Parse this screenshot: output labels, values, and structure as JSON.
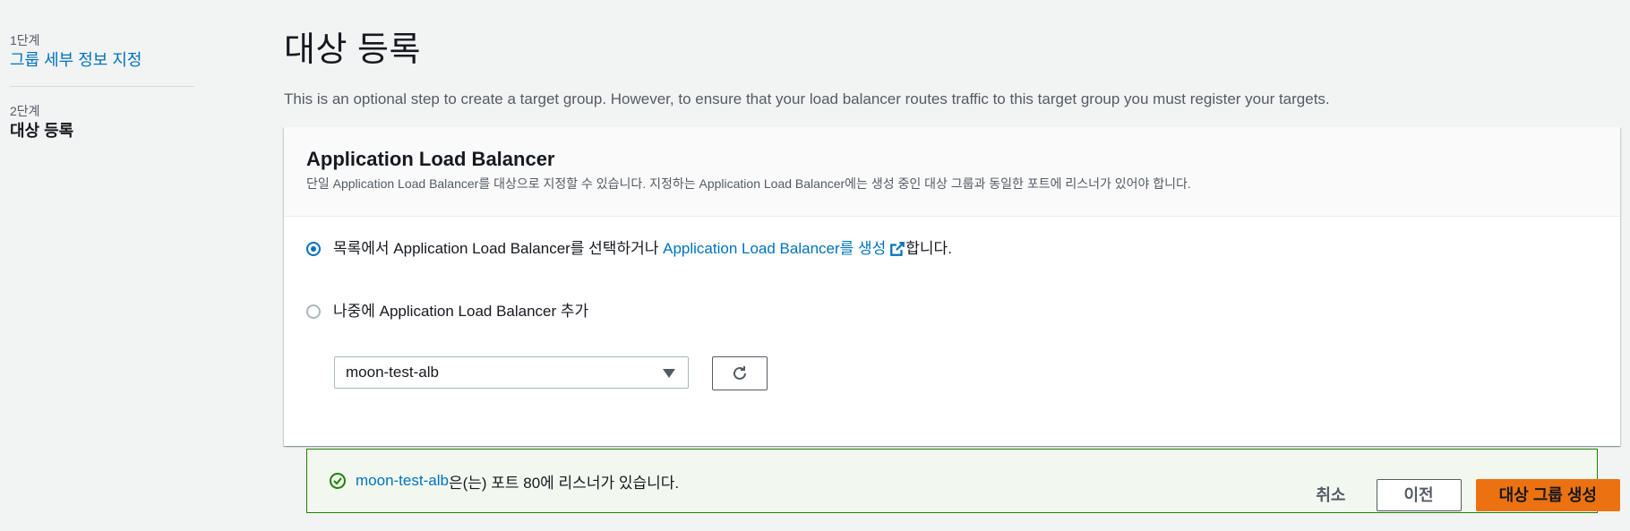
{
  "sidebar": {
    "steps": [
      {
        "number": "1단계",
        "label": "그룹 세부 정보 지정"
      },
      {
        "number": "2단계",
        "label": "대상 등록"
      }
    ]
  },
  "main": {
    "title": "대상 등록",
    "description": "This is an optional step to create a target group. However, to ensure that your load balancer routes traffic to this target group you must register your targets."
  },
  "card": {
    "title": "Application Load Balancer",
    "description": "단일 Application Load Balancer를 대상으로 지정할 수 있습니다. 지정하는 Application Load Balancer에는 생성 중인 대상 그룹과 동일한 포트에 리스너가 있어야 합니다.",
    "option_select": {
      "prefix": "목록에서 Application Load Balancer를 선택하거나 ",
      "link": "Application Load Balancer를 생성",
      "suffix": "합니다.",
      "checked": true
    },
    "select_value": "moon-test-alb",
    "option_later": {
      "label": "나중에 Application Load Balancer 추가",
      "checked": false
    },
    "alert": {
      "link": "moon-test-alb",
      "text": "은(는) 포트 80에 리스너가 있습니다."
    }
  },
  "actions": {
    "cancel": "취소",
    "previous": "이전",
    "create": "대상 그룹 생성"
  },
  "colors": {
    "link": "#0073bb",
    "primary": "#ec7211",
    "success": "#1d8102"
  },
  "icons": [
    "external-link-icon",
    "refresh-icon",
    "success-check-icon",
    "caret-down-icon"
  ]
}
